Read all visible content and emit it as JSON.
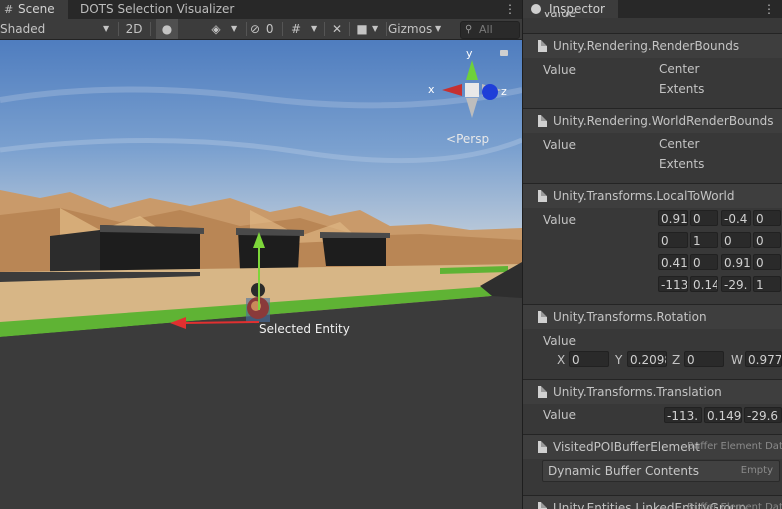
{
  "scene_tabs": {
    "scene": "Scene",
    "dots": "DOTS Selection Visualizer"
  },
  "toolbar": {
    "shading": "Shaded",
    "mode_2d": "2D",
    "hidden_count": "0",
    "gizmos": "Gizmos",
    "search_placeholder": "All"
  },
  "viewport": {
    "axis_x": "x",
    "axis_y": "y",
    "axis_z": "z",
    "projection": "Persp",
    "selected_label": "Selected Entity"
  },
  "inspector": {
    "tab": "Inspector",
    "top_label": "Value",
    "render_bounds": {
      "title": "Unity.Rendering.RenderBounds",
      "value_label": "Value",
      "sub": [
        "Center",
        "Extents"
      ]
    },
    "world_render_bounds": {
      "title": "Unity.Rendering.WorldRenderBounds",
      "value_label": "Value",
      "sub": [
        "Center",
        "Extents"
      ]
    },
    "local_to_world": {
      "title": "Unity.Transforms.LocalToWorld",
      "value_label": "Value",
      "matrix": [
        [
          "0.91",
          "0",
          "-0.4",
          "0"
        ],
        [
          "0",
          "1",
          "0",
          "0"
        ],
        [
          "0.41",
          "0",
          "0.91",
          "0"
        ],
        [
          "-113",
          "0.14",
          "-29.",
          "1"
        ]
      ]
    },
    "rotation": {
      "title": "Unity.Transforms.Rotation",
      "value_label": "Value",
      "x_label": "X",
      "x": "0",
      "y_label": "Y",
      "y": "0.2098",
      "z_label": "Z",
      "z": "0",
      "w_label": "W",
      "w": "0.977"
    },
    "translation": {
      "title": "Unity.Transforms.Translation",
      "value_label": "Value",
      "values": [
        "-113.",
        "0.149",
        "-29.6"
      ]
    },
    "visited_poi": {
      "title": "VisitedPOIBufferElement",
      "tag": "Buffer Element Data",
      "contents": "Dynamic Buffer Contents",
      "empty": "Empty"
    },
    "linked_entity": {
      "title": "Unity.Entities.LinkedEntityGroup",
      "tag": "Buffer Element Data"
    }
  },
  "colors": {
    "sky_top": "#5a86c4",
    "sand": "#d9b88a",
    "grass": "#5fb334",
    "road": "#3a3a3a"
  }
}
